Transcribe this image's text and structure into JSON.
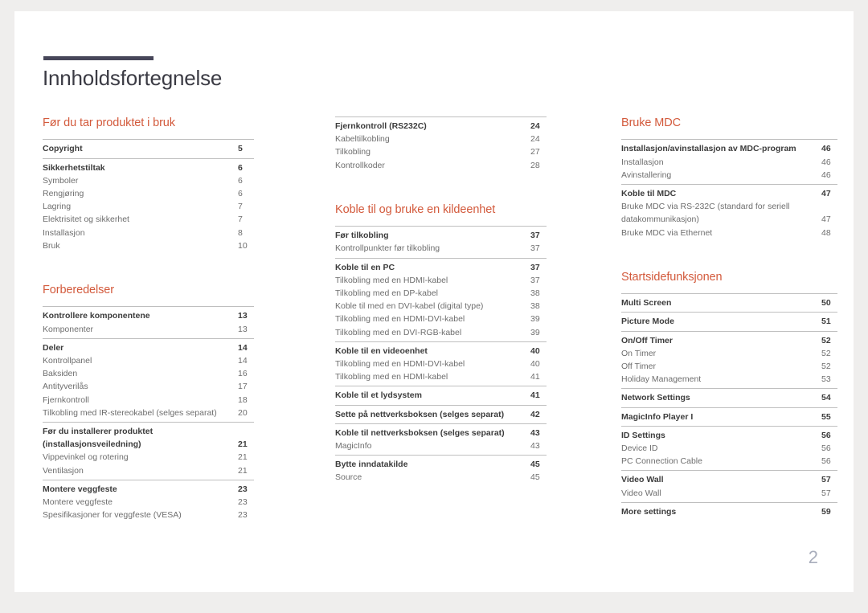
{
  "document": {
    "title": "Innholdsfortegnelse",
    "page_number": "2",
    "accent_color": "#d35a3c",
    "title_rule_color": "#474659"
  },
  "columns": [
    {
      "sections": [
        {
          "heading": "Før du tar produktet i bruk",
          "groups": [
            {
              "entries": [
                {
                  "level": 1,
                  "text": "Copyright",
                  "page": "5"
                }
              ]
            },
            {
              "entries": [
                {
                  "level": 1,
                  "text": "Sikkerhetstiltak",
                  "page": "6"
                },
                {
                  "level": 2,
                  "text": "Symboler",
                  "page": "6"
                },
                {
                  "level": 2,
                  "text": "Rengjøring",
                  "page": "6"
                },
                {
                  "level": 2,
                  "text": "Lagring",
                  "page": "7"
                },
                {
                  "level": 2,
                  "text": "Elektrisitet og sikkerhet",
                  "page": "7"
                },
                {
                  "level": 2,
                  "text": "Installasjon",
                  "page": "8"
                },
                {
                  "level": 2,
                  "text": "Bruk",
                  "page": "10"
                }
              ]
            }
          ]
        },
        {
          "heading": "Forberedelser",
          "groups": [
            {
              "entries": [
                {
                  "level": 1,
                  "text": "Kontrollere komponentene",
                  "page": "13"
                },
                {
                  "level": 2,
                  "text": "Komponenter",
                  "page": "13"
                }
              ]
            },
            {
              "entries": [
                {
                  "level": 1,
                  "text": "Deler",
                  "page": "14"
                },
                {
                  "level": 2,
                  "text": "Kontrollpanel",
                  "page": "14"
                },
                {
                  "level": 2,
                  "text": "Baksiden",
                  "page": "16"
                },
                {
                  "level": 2,
                  "text": "Antityverilås",
                  "page": "17"
                },
                {
                  "level": 2,
                  "text": "Fjernkontroll",
                  "page": "18"
                },
                {
                  "level": 2,
                  "text": "Tilkobling med IR-stereokabel (selges separat)",
                  "page": "20"
                }
              ]
            },
            {
              "entries": [
                {
                  "level": 1,
                  "text": "Før du installerer produktet (installasjonsveiledning)",
                  "page": "21"
                },
                {
                  "level": 2,
                  "text": "Vippevinkel og rotering",
                  "page": "21"
                },
                {
                  "level": 2,
                  "text": "Ventilasjon",
                  "page": "21"
                }
              ]
            },
            {
              "entries": [
                {
                  "level": 1,
                  "text": "Montere veggfeste",
                  "page": "23"
                },
                {
                  "level": 2,
                  "text": "Montere veggfeste",
                  "page": "23"
                },
                {
                  "level": 2,
                  "text": "Spesifikasjoner for veggfeste (VESA)",
                  "page": "23"
                }
              ]
            }
          ]
        }
      ]
    },
    {
      "sections": [
        {
          "heading": "",
          "groups": [
            {
              "entries": [
                {
                  "level": 1,
                  "text": "Fjernkontroll (RS232C)",
                  "page": "24"
                },
                {
                  "level": 2,
                  "text": "Kabeltilkobling",
                  "page": "24"
                },
                {
                  "level": 2,
                  "text": "Tilkobling",
                  "page": "27"
                },
                {
                  "level": 2,
                  "text": "Kontrollkoder",
                  "page": "28"
                }
              ]
            }
          ]
        },
        {
          "heading": "Koble til og bruke en kildeenhet",
          "groups": [
            {
              "entries": [
                {
                  "level": 1,
                  "text": "Før tilkobling",
                  "page": "37"
                },
                {
                  "level": 2,
                  "text": "Kontrollpunkter før tilkobling",
                  "page": "37"
                }
              ]
            },
            {
              "entries": [
                {
                  "level": 1,
                  "text": "Koble til en PC",
                  "page": "37"
                },
                {
                  "level": 2,
                  "text": "Tilkobling med en HDMI-kabel",
                  "page": "37"
                },
                {
                  "level": 2,
                  "text": "Tilkobling med en DP-kabel",
                  "page": "38"
                },
                {
                  "level": 2,
                  "text": "Koble til med en DVI-kabel (digital type)",
                  "page": "38"
                },
                {
                  "level": 2,
                  "text": "Tilkobling med en HDMI-DVI-kabel",
                  "page": "39"
                },
                {
                  "level": 2,
                  "text": "Tilkobling med en DVI-RGB-kabel",
                  "page": "39"
                }
              ]
            },
            {
              "entries": [
                {
                  "level": 1,
                  "text": "Koble til en videoenhet",
                  "page": "40"
                },
                {
                  "level": 2,
                  "text": "Tilkobling med en HDMI-DVI-kabel",
                  "page": "40"
                },
                {
                  "level": 2,
                  "text": "Tilkobling med en HDMI-kabel",
                  "page": "41"
                }
              ]
            },
            {
              "entries": [
                {
                  "level": 1,
                  "text": "Koble til et lydsystem",
                  "page": "41"
                }
              ]
            },
            {
              "entries": [
                {
                  "level": 1,
                  "text": "Sette på nettverksboksen (selges separat)",
                  "page": "42"
                }
              ]
            },
            {
              "entries": [
                {
                  "level": 1,
                  "text": "Koble til nettverksboksen (selges separat)",
                  "page": "43"
                },
                {
                  "level": 2,
                  "text": "MagicInfo",
                  "page": "43"
                }
              ]
            },
            {
              "entries": [
                {
                  "level": 1,
                  "text": "Bytte inndatakilde",
                  "page": "45"
                },
                {
                  "level": 2,
                  "text": "Source",
                  "page": "45"
                }
              ]
            }
          ]
        }
      ]
    },
    {
      "sections": [
        {
          "heading": "Bruke MDC",
          "groups": [
            {
              "entries": [
                {
                  "level": 1,
                  "text": "Installasjon/avinstallasjon av MDC-program",
                  "page": "46"
                },
                {
                  "level": 2,
                  "text": "Installasjon",
                  "page": "46"
                },
                {
                  "level": 2,
                  "text": "Avinstallering",
                  "page": "46"
                }
              ]
            },
            {
              "entries": [
                {
                  "level": 1,
                  "text": "Koble til MDC",
                  "page": "47"
                },
                {
                  "level": 2,
                  "text": "Bruke MDC via RS-232C (standard for seriell datakommunikasjon)",
                  "page": "47"
                },
                {
                  "level": 2,
                  "text": "Bruke MDC via Ethernet",
                  "page": "48"
                }
              ]
            }
          ]
        },
        {
          "heading": "Startsidefunksjonen",
          "groups": [
            {
              "entries": [
                {
                  "level": 1,
                  "text": "Multi Screen",
                  "page": "50"
                }
              ]
            },
            {
              "entries": [
                {
                  "level": 1,
                  "text": "Picture Mode",
                  "page": "51"
                }
              ]
            },
            {
              "entries": [
                {
                  "level": 1,
                  "text": "On/Off Timer",
                  "page": "52"
                },
                {
                  "level": 2,
                  "text": "On Timer",
                  "page": "52"
                },
                {
                  "level": 2,
                  "text": "Off Timer",
                  "page": "52"
                },
                {
                  "level": 2,
                  "text": "Holiday Management",
                  "page": "53"
                }
              ]
            },
            {
              "entries": [
                {
                  "level": 1,
                  "text": "Network Settings",
                  "page": "54"
                }
              ]
            },
            {
              "entries": [
                {
                  "level": 1,
                  "text": "MagicInfo Player I",
                  "page": "55"
                }
              ]
            },
            {
              "entries": [
                {
                  "level": 1,
                  "text": "ID Settings",
                  "page": "56"
                },
                {
                  "level": 2,
                  "text": "Device ID",
                  "page": "56"
                },
                {
                  "level": 2,
                  "text": "PC Connection Cable",
                  "page": "56"
                }
              ]
            },
            {
              "entries": [
                {
                  "level": 1,
                  "text": "Video Wall",
                  "page": "57"
                },
                {
                  "level": 2,
                  "text": "Video Wall",
                  "page": "57"
                }
              ]
            },
            {
              "entries": [
                {
                  "level": 1,
                  "text": "More settings",
                  "page": "59"
                }
              ]
            }
          ]
        }
      ]
    }
  ]
}
